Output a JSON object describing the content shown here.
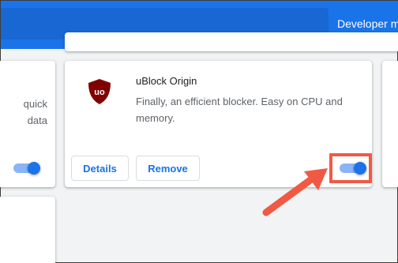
{
  "header": {
    "developer_mode_label": "Developer mo"
  },
  "left_card": {
    "description_lines": [
      "quick",
      "data"
    ],
    "toggle_enabled": true
  },
  "extension": {
    "name": "uBlock Origin",
    "description": "Finally, an efficient blocker. Easy on CPU and memory.",
    "icon": "ublock-origin-shield-icon",
    "icon_text": "uo",
    "details_label": "Details",
    "remove_label": "Remove",
    "toggle_enabled": true
  },
  "annotation": {
    "highlight_color": "#f05a44",
    "icon": "arrow-pointer-icon"
  },
  "colors": {
    "accent": "#1a73e8",
    "toggle_track": "#8ab4f8",
    "background": "#f1f3f4"
  }
}
